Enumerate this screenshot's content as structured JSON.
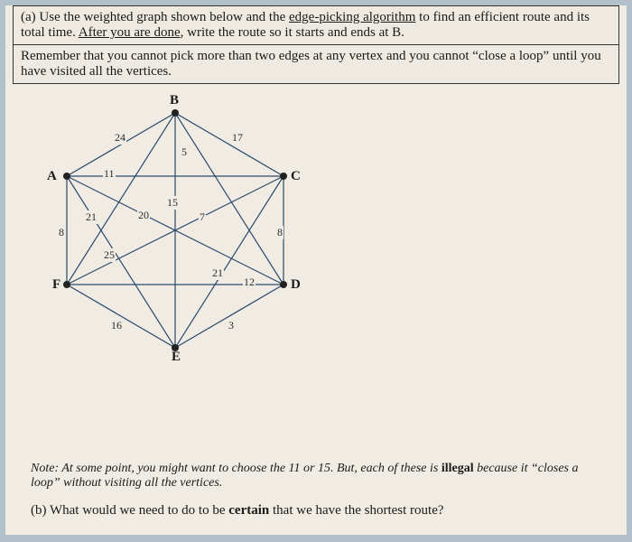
{
  "qa": {
    "part": "(a)",
    "intro1": " Use the weighted graph shown below and the ",
    "algo": "edge-picking algorithm",
    "intro2": " to find an efficient route and its total time. ",
    "after": "After you are done",
    "intro3": ", write the route so it starts and ends at B."
  },
  "reminder": "Remember that you cannot pick more than two edges at any vertex and you cannot “close a loop” until you have visited all the vertices.",
  "graph": {
    "vertices": {
      "A": "A",
      "B": "B",
      "C": "C",
      "D": "D",
      "E": "E",
      "F": "F"
    },
    "edges": {
      "AB": "24",
      "BC": "17",
      "AC": "11",
      "BE": "5",
      "BD": "15",
      "BF": "20",
      "AD": "7",
      "AE": "21",
      "CE": "21",
      "CF": "25",
      "CD": "8",
      "AF": "8",
      "FD": "12",
      "FE": "16",
      "ED": "3"
    }
  },
  "note": {
    "pre": "Note: At some point, you might want to choose the 11 or 15. But, each of these is ",
    "word": "illegal",
    "post": " because it “closes a loop” without visiting all the vertices."
  },
  "qb": {
    "part": "(b)",
    "pre": " What would we need to do to be ",
    "certain": "certain",
    "post": " that we have the shortest route?"
  }
}
